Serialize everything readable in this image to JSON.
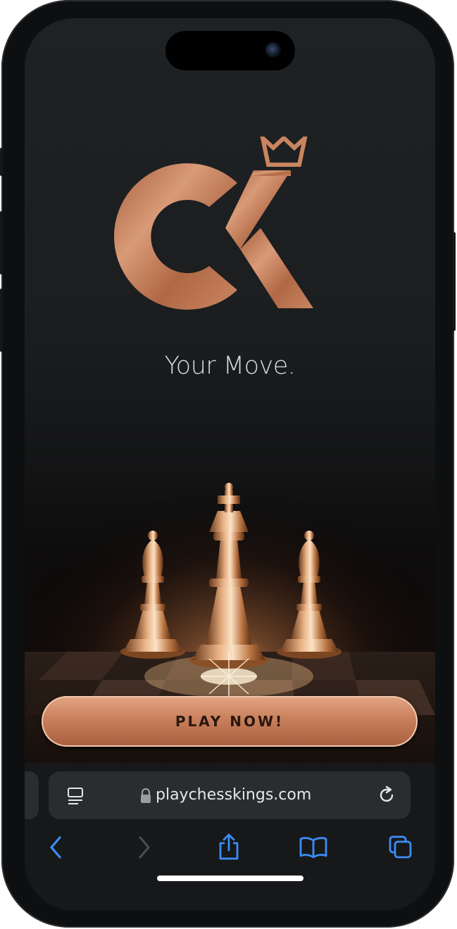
{
  "app": {
    "tagline": "Your Move.",
    "play_button_label": "PLAY NOW!"
  },
  "browser": {
    "url": "playchesskings.com"
  },
  "colors": {
    "accent_copper": "#c67f5a",
    "toolbar_blue": "#3a8ef6"
  },
  "icons": {
    "logo": "ck-crown-logo",
    "reader": "page-menu-icon",
    "lock": "lock-icon",
    "reload": "reload-icon",
    "back": "back-arrow-icon",
    "forward": "forward-arrow-icon",
    "share": "share-icon",
    "bookmarks": "bookmarks-icon",
    "tabs": "tabs-icon"
  }
}
